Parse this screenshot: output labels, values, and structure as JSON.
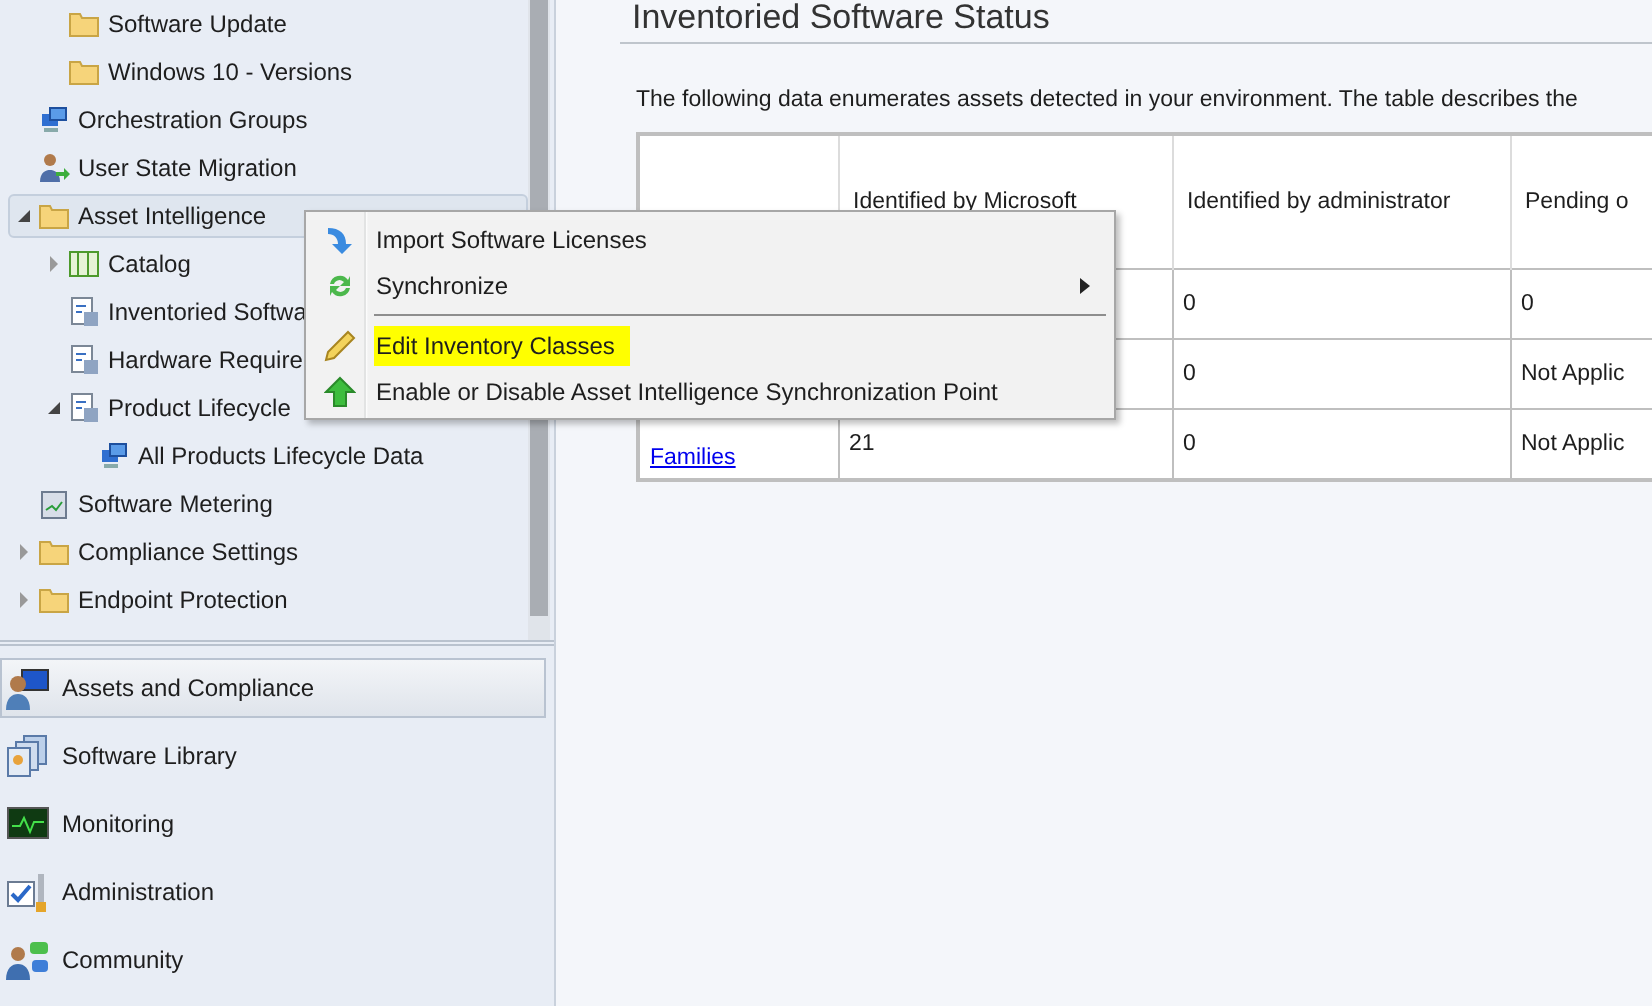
{
  "tree": {
    "continued_children": [
      {
        "label": "Software Update",
        "kind": "folder",
        "selected": false
      },
      {
        "label": "Windows 10 - Versions",
        "kind": "folder",
        "selected": false
      }
    ],
    "items": [
      {
        "label": "Orchestration Groups",
        "kind": "computers",
        "selected": false
      },
      {
        "label": "User State Migration",
        "kind": "user",
        "selected": false
      },
      {
        "label": "Asset Intelligence",
        "kind": "folder",
        "selected": true,
        "expanded": true,
        "children": [
          {
            "label": "Catalog",
            "kind": "catalog",
            "selected": false,
            "expanded": false
          },
          {
            "label": "Inventoried Softwa",
            "kind": "report",
            "selected": false
          },
          {
            "label": "Hardware Require",
            "kind": "report",
            "selected": false
          },
          {
            "label": "Product Lifecycle",
            "kind": "report",
            "selected": false,
            "expanded": true,
            "children": [
              {
                "label": "All Products Lifecycle Data",
                "kind": "computers",
                "selected": false
              }
            ]
          }
        ]
      },
      {
        "label": "Software Metering",
        "kind": "meter",
        "selected": false
      },
      {
        "label": "Compliance Settings",
        "kind": "folder",
        "selected": false,
        "expanded": false
      },
      {
        "label": "Endpoint Protection",
        "kind": "folder",
        "selected": false,
        "expanded": false
      }
    ]
  },
  "workspaces": [
    {
      "label": "Assets and Compliance",
      "kind": "assets",
      "selected": true
    },
    {
      "label": "Software Library",
      "kind": "library",
      "selected": false
    },
    {
      "label": "Monitoring",
      "kind": "monitor",
      "selected": false
    },
    {
      "label": "Administration",
      "kind": "admin",
      "selected": false
    },
    {
      "label": "Community",
      "kind": "community",
      "selected": false
    }
  ],
  "main": {
    "title": "Inventoried Software Status",
    "description": "The following data enumerates assets detected in your environment. The table describes the",
    "table": {
      "columns": [
        "",
        "Identified by Microsoft",
        "Identified by administrator",
        "Pending o"
      ],
      "rows": [
        {
          "cells": [
            "",
            "",
            "0",
            "0"
          ]
        },
        {
          "cells": [
            "",
            "",
            "0",
            "Not Applic"
          ]
        },
        {
          "cells": [
            "Families",
            "21",
            "0",
            "Not Applic"
          ]
        }
      ]
    }
  },
  "context_menu": [
    {
      "label": "Import Software Licenses",
      "kind": "import",
      "selected": false
    },
    {
      "label": "Synchronize",
      "kind": "sync",
      "selected": false,
      "submenu": true
    },
    {
      "label": "Edit Inventory Classes",
      "kind": "pencil",
      "selected": true,
      "separator_before": true
    },
    {
      "label": "Enable or Disable Asset Intelligence Synchronization Point",
      "kind": "up",
      "selected": false
    }
  ]
}
